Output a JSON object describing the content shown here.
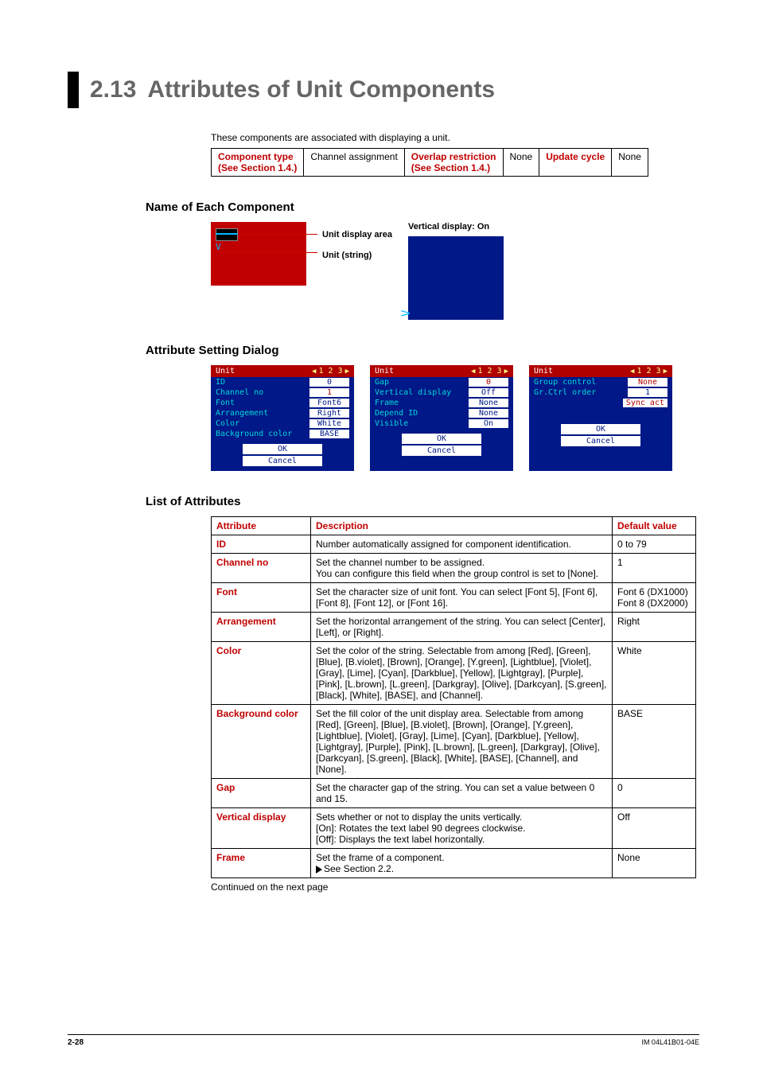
{
  "heading": {
    "number": "2.13",
    "title": "Attributes of Unit Components"
  },
  "intro": "These components are associated with displaying a unit.",
  "comp_table": {
    "h1": "Component type",
    "h1b": "(See Section 1.4.)",
    "v1": "Channel assignment",
    "h2": "Overlap restriction",
    "h2b": "(See Section 1.4.)",
    "v2": "None",
    "h3": "Update cycle",
    "v3": "None"
  },
  "sub1": "Name of Each Component",
  "labels": {
    "unit_area": "Unit display area",
    "unit_string": "Unit (string)",
    "vertical_on": "Vertical display: On",
    "panel_glyph": "V"
  },
  "sub2": "Attribute Setting Dialog",
  "dialog1": {
    "title": "Unit",
    "pages": "1 2 3",
    "rows": [
      {
        "label": "ID",
        "value": "0"
      },
      {
        "label": "Channel no",
        "value": "1"
      },
      {
        "label": "Font",
        "value": "Font6"
      },
      {
        "label": "Arrangement",
        "value": "Right"
      },
      {
        "label": "Color",
        "value": "White"
      },
      {
        "label": "Background color",
        "value": "BASE"
      }
    ],
    "ok": "OK",
    "cancel": "Cancel"
  },
  "dialog2": {
    "title": "Unit",
    "pages": "1 2 3",
    "rows": [
      {
        "label": "Gap",
        "value": "0"
      },
      {
        "label": "Vertical display",
        "value": "Off"
      },
      {
        "label": "Frame",
        "value": "None"
      },
      {
        "label": "Depend ID",
        "value": "None"
      },
      {
        "label": "Visible",
        "value": "On"
      }
    ],
    "ok": "OK",
    "cancel": "Cancel"
  },
  "dialog3": {
    "title": "Unit",
    "pages": "1 2 3",
    "rows": [
      {
        "label": "Group control",
        "value": "None"
      },
      {
        "label": "Gr.Ctrl order",
        "value": "1"
      },
      {
        "label": "",
        "value": "Sync act"
      }
    ],
    "ok": "OK",
    "cancel": "Cancel"
  },
  "sub3": "List of Attributes",
  "attr_table": {
    "headers": {
      "a": "Attribute",
      "d": "Description",
      "v": "Default value"
    },
    "rows": [
      {
        "a": "ID",
        "d": "Number automatically assigned for component identification.",
        "v": "0 to 79"
      },
      {
        "a": "Channel no",
        "d": "Set the channel number to be assigned.\nYou can configure this field when the group control is set to [None].",
        "v": "1"
      },
      {
        "a": "Font",
        "d": "Set the character size of unit font. You can select [Font 5], [Font 6], [Font 8], [Font 12], or [Font 16].",
        "v": "Font 6 (DX1000)\nFont 8 (DX2000)"
      },
      {
        "a": "Arrangement",
        "d": "Set the horizontal arrangement of the string. You can select [Center], [Left], or [Right].",
        "v": "Right"
      },
      {
        "a": "Color",
        "d": "Set the color of the string. Selectable from among [Red], [Green], [Blue], [B.violet], [Brown], [Orange], [Y.green], [Lightblue], [Violet], [Gray], [Lime], [Cyan], [Darkblue], [Yellow], [Lightgray], [Purple], [Pink], [L.brown], [L.green], [Darkgray], [Olive], [Darkcyan], [S.green], [Black], [White], [BASE], and [Channel].",
        "v": "White"
      },
      {
        "a": "Background color",
        "d": "Set the fill color of the unit display area. Selectable from among [Red], [Green], [Blue], [B.violet], [Brown], [Orange], [Y.green], [Lightblue], [Violet], [Gray], [Lime], [Cyan], [Darkblue], [Yellow], [Lightgray], [Purple], [Pink], [L.brown], [L.green], [Darkgray], [Olive], [Darkcyan], [S.green], [Black], [White], [BASE], [Channel], and [None].",
        "v": "BASE"
      },
      {
        "a": "Gap",
        "d": "Set the character gap of the string. You can set a value between 0 and 15.",
        "v": "0"
      },
      {
        "a": "Vertical display",
        "d": "Sets whether or not to display the units vertically.\n[On]: Rotates the text label 90 degrees clockwise.\n[Off]: Displays the text label horizontally.",
        "v": "Off"
      },
      {
        "a": "Frame",
        "d": "Set the frame of a component.\n▶See Section 2.2.",
        "v": "None"
      }
    ]
  },
  "continued": "Continued on the next page",
  "footer": {
    "page": "2-28",
    "doc": "IM 04L41B01-04E"
  }
}
